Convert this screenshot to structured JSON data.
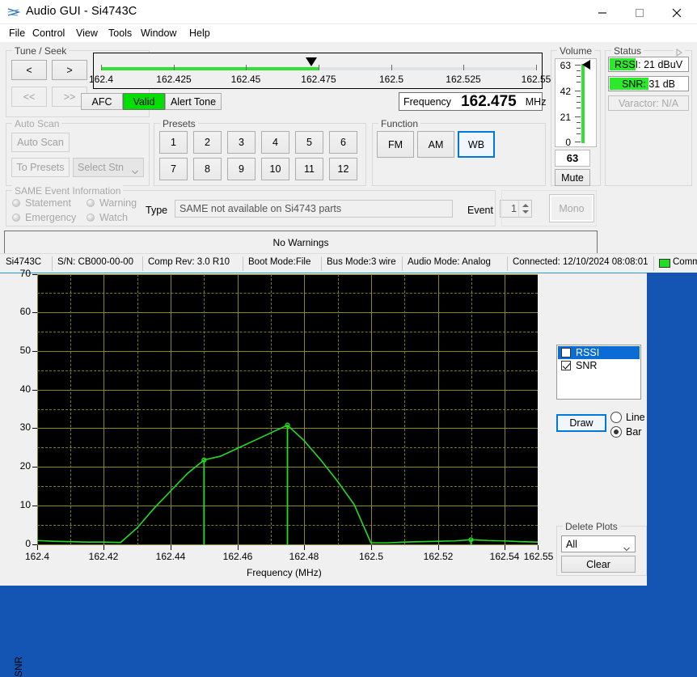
{
  "window": {
    "title": "Audio GUI - Si4743C",
    "icon": "antenna-icon",
    "minimize": "minimize-icon",
    "maximize": "maximize-icon",
    "close": "close-icon"
  },
  "menu": [
    {
      "label": "File"
    },
    {
      "label": "Control"
    },
    {
      "label": "View"
    },
    {
      "label": "Tools"
    },
    {
      "label": "Window"
    },
    {
      "label": "Help"
    }
  ],
  "tune_seek": {
    "title": "Tune / Seek",
    "buttons": [
      {
        "label": "<",
        "enabled": true
      },
      {
        "label": ">",
        "enabled": true
      },
      {
        "label": "<<",
        "enabled": false
      },
      {
        "label": ">>",
        "enabled": false
      }
    ]
  },
  "tune_slider": {
    "min": 162.4,
    "max": 162.55,
    "value": 162.475,
    "ticks": [
      "162.4",
      "162.425",
      "162.45",
      "162.475",
      "162.5",
      "162.525",
      "162.55"
    ]
  },
  "tune_buttons": [
    {
      "label": "AFC",
      "state": "normal"
    },
    {
      "label": "Valid",
      "state": "green"
    },
    {
      "label": "Alert Tone",
      "state": "normal"
    }
  ],
  "frequency": {
    "label": "Frequency",
    "value": "162.475",
    "unit": "MHz"
  },
  "auto_scan": {
    "title": "Auto Scan",
    "scan_button": "Auto Scan",
    "to_presets_button": "To Presets",
    "select_station": "Select Stn",
    "enabled": false
  },
  "presets": {
    "title": "Presets",
    "buttons": [
      "1",
      "2",
      "3",
      "4",
      "5",
      "6",
      "7",
      "8",
      "9",
      "10",
      "11",
      "12"
    ]
  },
  "function": {
    "title": "Function",
    "buttons": [
      "FM",
      "AM",
      "WB"
    ],
    "selected": "WB"
  },
  "volume": {
    "title": "Volume",
    "ticks": [
      "63",
      "42",
      "21",
      "0"
    ],
    "value": "63",
    "min": 0,
    "max": 63,
    "mute_label": "Mute"
  },
  "status": {
    "title": "Status",
    "expand_icon": "expand-triangle-icon",
    "rssi": {
      "text": "RSSI: 21 dBuV",
      "percent": 33
    },
    "snr": {
      "text": "SNR: 31 dB",
      "percent": 49
    },
    "varactor": {
      "text": "Varactor: N/A",
      "enabled": false
    }
  },
  "same_event": {
    "title": "SAME Event Information",
    "indicators": [
      "Statement",
      "Warning",
      "Emergency",
      "Watch"
    ],
    "type_label": "Type",
    "type_value": "SAME not available on Si4743 parts",
    "event_label": "Event",
    "event_value": "1"
  },
  "mono_button": {
    "label": "Mono",
    "enabled": false
  },
  "warnings": {
    "text": "No Warnings"
  },
  "statusbar": [
    {
      "label": "Si4743C"
    },
    {
      "label": "S/N: CB000-00-00"
    },
    {
      "label": "Comp Rev: 3.0 R10"
    },
    {
      "label": "Boot Mode:File"
    },
    {
      "label": "Bus Mode:3 wire"
    },
    {
      "label": "Audio Mode: Analog"
    },
    {
      "label": "Connected: 12/10/2024 08:08:01"
    },
    {
      "label": "Comm",
      "led": "#22dd22"
    }
  ],
  "legend": {
    "items": [
      {
        "label": "RSSI",
        "checked": false,
        "selected": true
      },
      {
        "label": "SNR",
        "checked": true,
        "selected": false
      }
    ],
    "draw_button": "Draw",
    "modes": [
      {
        "label": "Line",
        "selected": false
      },
      {
        "label": "Bar",
        "selected": true
      }
    ]
  },
  "delete_plots": {
    "title": "Delete Plots",
    "selected": "All",
    "clear_button": "Clear"
  },
  "chart_data": {
    "type": "line",
    "title": "",
    "xlabel": "Frequency (MHz)",
    "ylabel": "SNR",
    "xlim": [
      162.4,
      162.55
    ],
    "ylim": [
      0,
      70
    ],
    "xticks": [
      "162.4",
      "162.42",
      "162.44",
      "162.46",
      "162.48",
      "162.5",
      "162.52",
      "162.54",
      "162.55"
    ],
    "xtick_values": [
      162.4,
      162.42,
      162.44,
      162.46,
      162.48,
      162.5,
      162.52,
      162.54,
      162.55
    ],
    "yticks": [
      "0",
      "10",
      "20",
      "30",
      "40",
      "50",
      "60",
      "70"
    ],
    "ytick_values": [
      0,
      10,
      20,
      30,
      40,
      50,
      60,
      70
    ],
    "grid": true,
    "legend_position": "right",
    "series": [
      {
        "name": "SNR",
        "color": "#22dd22",
        "x": [
          162.4,
          162.405,
          162.41,
          162.415,
          162.42,
          162.425,
          162.43,
          162.435,
          162.44,
          162.445,
          162.45,
          162.455,
          162.46,
          162.465,
          162.47,
          162.475,
          162.48,
          162.485,
          162.49,
          162.495,
          162.5,
          162.505,
          162.51,
          162.515,
          162.52,
          162.525,
          162.53,
          162.535,
          162.54,
          162.545,
          162.55
        ],
        "y": [
          1.2,
          1.0,
          0.9,
          0.8,
          0.8,
          0.7,
          4.5,
          9.5,
          14.0,
          18.5,
          22.0,
          23.0,
          25.0,
          27.0,
          29.0,
          31.0,
          27.0,
          22.0,
          16.5,
          10.5,
          0.6,
          0.6,
          0.8,
          0.9,
          1.0,
          1.1,
          1.4,
          1.2,
          1.1,
          0.9,
          0.8
        ]
      }
    ],
    "bars": [
      {
        "x": 162.45,
        "y": 22.0
      },
      {
        "x": 162.475,
        "y": 31.0
      },
      {
        "x": 162.53,
        "y": 1.4
      }
    ],
    "markers": [
      {
        "x": 162.45,
        "y": 22.0
      },
      {
        "x": 162.475,
        "y": 31.0
      },
      {
        "x": 162.53,
        "y": 1.4
      }
    ]
  }
}
